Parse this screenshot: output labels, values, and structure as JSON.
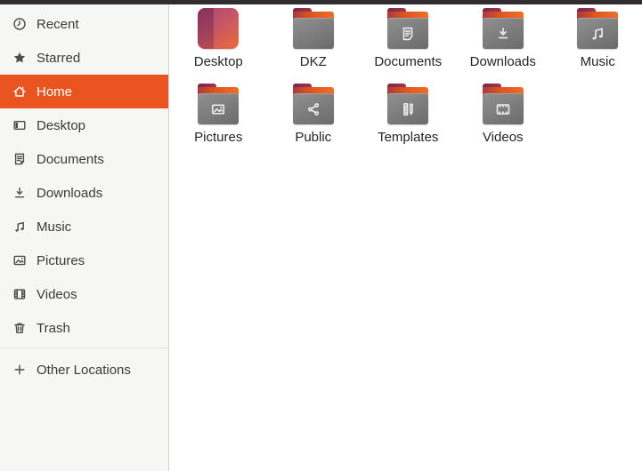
{
  "sidebar": {
    "items": [
      {
        "label": "Recent",
        "icon": "clock",
        "selected": false
      },
      {
        "label": "Starred",
        "icon": "star",
        "selected": false
      },
      {
        "label": "Home",
        "icon": "home",
        "selected": true
      },
      {
        "label": "Desktop",
        "icon": "desktop",
        "selected": false
      },
      {
        "label": "Documents",
        "icon": "document",
        "selected": false
      },
      {
        "label": "Downloads",
        "icon": "download",
        "selected": false
      },
      {
        "label": "Music",
        "icon": "music",
        "selected": false
      },
      {
        "label": "Pictures",
        "icon": "picture",
        "selected": false
      },
      {
        "label": "Videos",
        "icon": "video",
        "selected": false
      },
      {
        "label": "Trash",
        "icon": "trash",
        "selected": false
      }
    ],
    "footer_item": {
      "label": "Other Locations",
      "icon": "plus"
    }
  },
  "files": {
    "items": [
      {
        "label": "Desktop",
        "icon": "desktop-special"
      },
      {
        "label": "DKZ",
        "icon": "folder"
      },
      {
        "label": "Documents",
        "icon": "folder-documents"
      },
      {
        "label": "Downloads",
        "icon": "folder-downloads"
      },
      {
        "label": "Music",
        "icon": "folder-music"
      },
      {
        "label": "Pictures",
        "icon": "folder-pictures"
      },
      {
        "label": "Public",
        "icon": "folder-public"
      },
      {
        "label": "Templates",
        "icon": "folder-templates"
      },
      {
        "label": "Videos",
        "icon": "folder-videos"
      }
    ]
  },
  "colors": {
    "accent": "#e95420",
    "sidebar_bg": "#f6f6f5",
    "topbar": "#302c30",
    "folder_gray": "#7b7b7b",
    "folder_tab_maroon": "#7d2350",
    "folder_tab_orange": "#e4571f",
    "selected_text": "#ffffff"
  }
}
